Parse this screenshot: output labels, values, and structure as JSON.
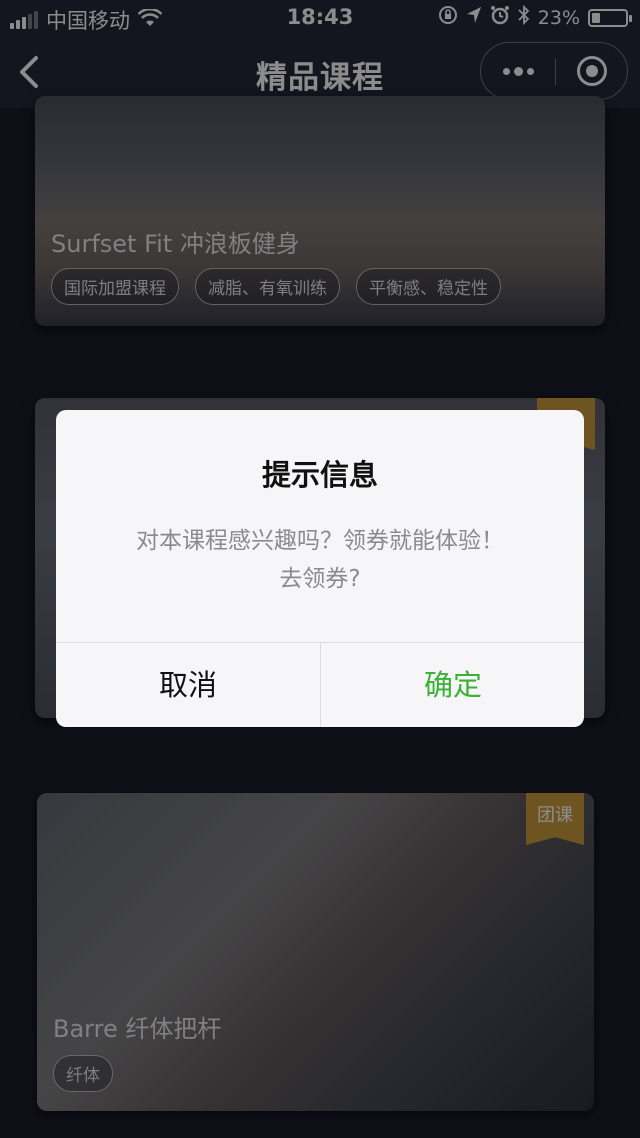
{
  "status_bar": {
    "carrier": "中国移动",
    "time": "18:43",
    "battery": "23%",
    "battery_level": 0.23
  },
  "nav": {
    "title": "精品课程"
  },
  "courses": [
    {
      "title": "Surfset Fit 冲浪板健身",
      "tags": [
        "国际加盟课程",
        "减脂、有氧训练",
        "平衡感、稳定性"
      ]
    },
    {
      "ribbon": "",
      "title": ""
    },
    {
      "ribbon": "团课",
      "title": "Barre 纤体把杆",
      "tags": [
        "纤体"
      ]
    }
  ],
  "dialog": {
    "title": "提示信息",
    "message_line1": "对本课程感兴趣吗？领券就能体验！",
    "message_line2": "去领券?",
    "cancel_label": "取消",
    "confirm_label": "确定"
  },
  "colors": {
    "background": "#1a1d2b",
    "navbar": "#23283a",
    "confirm": "#3cb034",
    "ribbon": "#c99a3d"
  }
}
